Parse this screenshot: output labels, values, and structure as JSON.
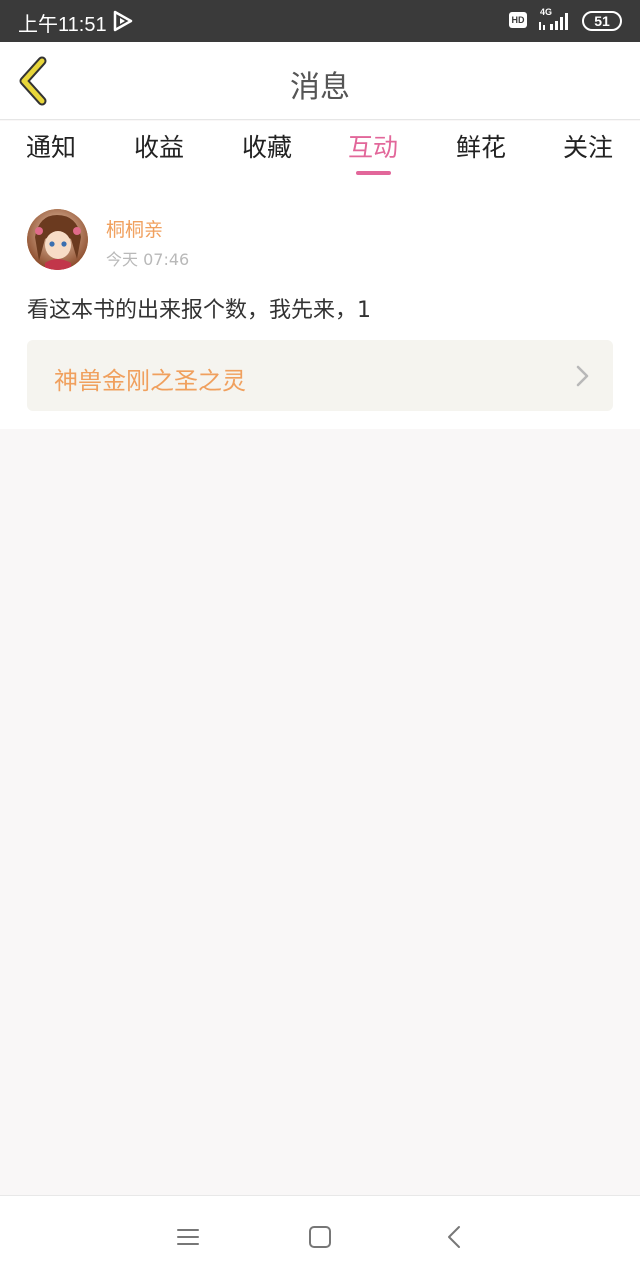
{
  "status_bar": {
    "time": "上午11:51",
    "hd": "HD",
    "network": "4G",
    "battery": "51"
  },
  "header": {
    "title": "消息",
    "back_icon": "chevron-left-icon"
  },
  "tabs": [
    {
      "label": "通知",
      "active": false
    },
    {
      "label": "收益",
      "active": false
    },
    {
      "label": "收藏",
      "active": false
    },
    {
      "label": "互动",
      "active": true
    },
    {
      "label": "鲜花",
      "active": false
    },
    {
      "label": "关注",
      "active": false
    }
  ],
  "message": {
    "username": "桐桐亲",
    "time": "今天 07:46",
    "body": "看这本书的出来报个数，我先来，1",
    "book_title": "神兽金刚之圣之灵"
  },
  "colors": {
    "accent": "#e2679a",
    "username": "#f0a05e",
    "back_arrow": "#e8d63a"
  },
  "nav": {
    "icons": [
      "menu-icon",
      "home-icon",
      "back-icon"
    ]
  }
}
